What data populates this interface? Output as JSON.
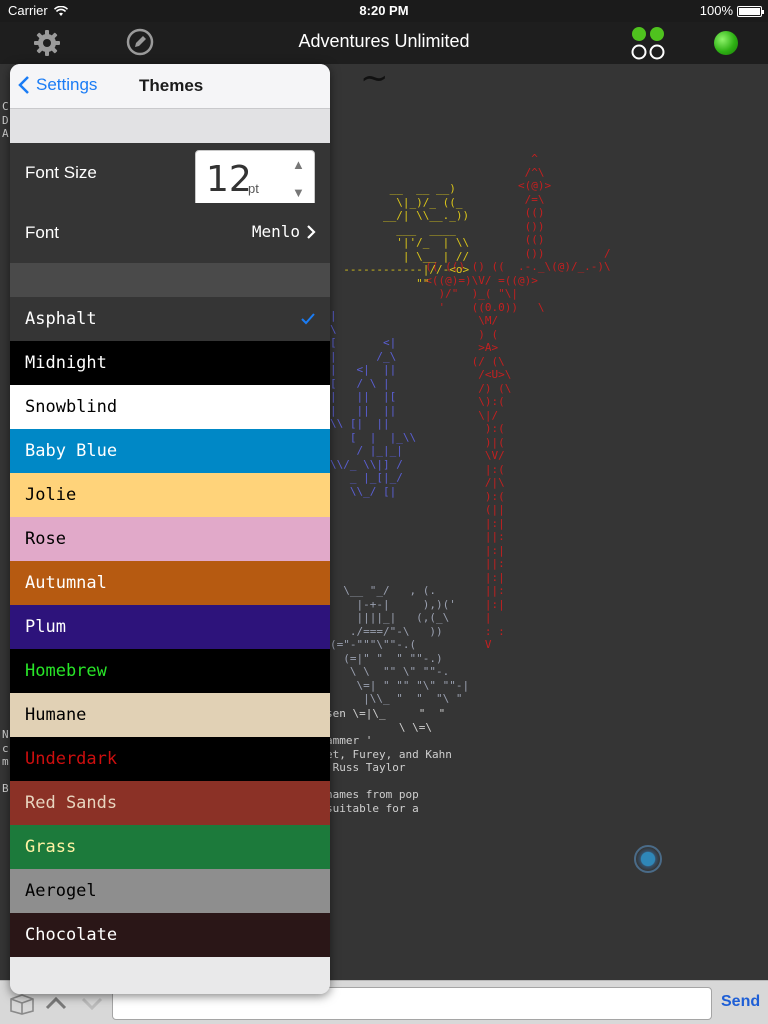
{
  "statusbar": {
    "carrier": "Carrier",
    "time": "8:20 PM",
    "battery": "100%"
  },
  "navbar": {
    "title": "Adventures Unlimited"
  },
  "icons": {
    "gear": "gear-icon",
    "edit": "pencil-icon",
    "quad": "four-circles-icon",
    "status": "green-dot-icon",
    "box": "package-icon",
    "up": "chevron-up-icon",
    "down": "chevron-down-icon",
    "back": "chevron-left-icon",
    "check": "checkmark-icon",
    "disclosure": "chevron-right-icon"
  },
  "settings": {
    "back_label": "Settings",
    "title": "Themes",
    "font_size_label": "Font Size",
    "font_size_value": "12",
    "font_size_unit": "pt",
    "stepper_up": "▲",
    "stepper_down": "▼",
    "font_label": "Font",
    "font_value": "Menlo"
  },
  "themes": [
    {
      "name": "Asphalt",
      "bg": "#353535",
      "fg": "#ffffff",
      "selected": true
    },
    {
      "name": "Midnight",
      "bg": "#000000",
      "fg": "#ffffff",
      "selected": false
    },
    {
      "name": "Snowblind",
      "bg": "#ffffff",
      "fg": "#000000",
      "selected": false
    },
    {
      "name": "Baby Blue",
      "bg": "#0088c6",
      "fg": "#ffffff",
      "selected": false
    },
    {
      "name": "Jolie",
      "bg": "#ffd37a",
      "fg": "#000000",
      "selected": false
    },
    {
      "name": "Rose",
      "bg": "#e1a9c9",
      "fg": "#000000",
      "selected": false
    },
    {
      "name": "Autumnal",
      "bg": "#b65a11",
      "fg": "#ffffff",
      "selected": false
    },
    {
      "name": "Plum",
      "bg": "#2d137b",
      "fg": "#ffffff",
      "selected": false
    },
    {
      "name": "Homebrew",
      "bg": "#000000",
      "fg": "#28e528",
      "selected": false
    },
    {
      "name": "Humane",
      "bg": "#e1d1b5",
      "fg": "#000000",
      "selected": false
    },
    {
      "name": "Underdark",
      "bg": "#000000",
      "fg": "#cc0e0e",
      "selected": false
    },
    {
      "name": "Red Sands",
      "bg": "#8b3126",
      "fg": "#e8d5bf",
      "selected": false
    },
    {
      "name": "Grass",
      "bg": "#1c7a3b",
      "fg": "#fff2a3",
      "selected": false
    },
    {
      "name": "Aerogel",
      "bg": "#8e8e8e",
      "fg": "#000000",
      "selected": false
    },
    {
      "name": "Chocolate",
      "bg": "#2a1617",
      "fg": "#ffffff",
      "selected": false
    }
  ],
  "terminal": {
    "tilde": "~",
    "left_fragment": "C\nD\nA",
    "left_fragment_b": "N\nc\nm\n\nB",
    "rocket": "                  ^\n                 /^\\\n                <(@)>\n                 /=\\\n                 (()\n                 ())\n                 (()\n                 ())         /\n  (( (() () ((  .-._\\(@)/_.-)\\\n  <((@)=)\\V/ =((@)>\n    )/\"  )_( \"\\|\n    '    ((0.0))   \\\n          \\M/\n          ) (\n          >A>\n         (/ (\\\n          /<U>\\\n          /) (\\\n          \\):(\n          \\|/\n           ):(\n           )|(\n           \\V/\n           |:(\n           /|\\\n           ):(\n           (||\n           |:|\n           ||:\n           |:|\n           ||:\n           |:|\n           ||:\n           |:|\n           |  \n           : :\n           V",
    "yellow": "         __  __ __)\n          \\|_)/_ ((_\n        __/| \\\\__._))\n          ___  ____\n          '|'/_  | \\\\\n           | \\__ | //\n  ------------|//-<o>\n             \"\"",
    "blue": "|\n\\\n[       <|\n|      /_\\\n|   <|  ||\n[   / \\ |\n|   ||  |[\n|   ||  ||\n\\\\ [|  ||\n   [  |  |_\\\\\n    / |_|_|\n\\\\/_ \\\\|] /\n   _ |_[|_/\n   \\\\_/ [|",
    "grey": "  \\__ \"_/   , (.\n    |-+-|     ),)('\n    ||||_|   (,(_\\\n   ./===/\"-\\   ))\n(=\"-\"\"\"\\\"\"-.(\n  (=|\" \"  \" \"\"-.)\n   \\ \\  \"\" \\\" \"\"-.\n    \\=| \" \"\" \"\\\" \"\"-|\n     |\\\\_ \"  \"  \"\\ \"\n",
    "credits": "sen \\=|\\_     \"  \"\n           \\ \\=\\\nammer '\net, Furey, and Kahn\n Russ Taylor\n\nnames from pop\nsuitable for a"
  },
  "input": {
    "placeholder": "",
    "send_label": "Send"
  }
}
